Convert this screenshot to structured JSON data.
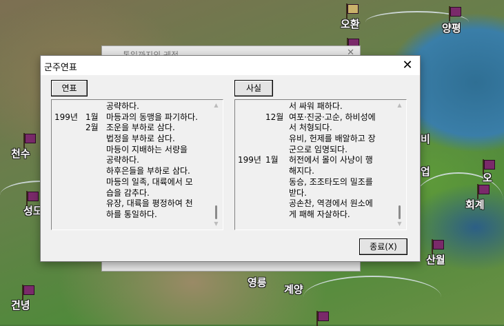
{
  "map": {
    "cities": [
      "오환",
      "양평",
      "천수",
      "성도",
      "건녕",
      "영릉",
      "계양",
      "산월",
      "회계",
      "오",
      "업",
      "비"
    ]
  },
  "back_window": {
    "title": "통일까지의 궤적"
  },
  "dialog": {
    "title": "군주연표",
    "close_glyph": "✕",
    "left_button": "연표",
    "right_button": "사실",
    "ok_button": "종료(X)",
    "left_rows": [
      {
        "year": "",
        "month": "",
        "text": "공략하다."
      },
      {
        "year": "199년",
        "month": "1월",
        "text": "마등과의 동맹을 파기하다."
      },
      {
        "year": "",
        "month": "2월",
        "text": "조운을 부하로 삼다."
      },
      {
        "year": "",
        "month": "",
        "text": "법정을 부하로 삼다."
      },
      {
        "year": "",
        "month": "",
        "text": "마등이 지배하는 서량을"
      },
      {
        "year": "",
        "month": "",
        "text": "공략하다."
      },
      {
        "year": "",
        "month": "",
        "text": "하후은들을 부하로 삼다."
      },
      {
        "year": "",
        "month": "",
        "text": "마등의 일족, 대륙에서 모"
      },
      {
        "year": "",
        "month": "",
        "text": "습을 감추다."
      },
      {
        "year": "",
        "month": "",
        "text": "유장, 대륙을 평정하여 천"
      },
      {
        "year": "",
        "month": "",
        "text": "하를 통일하다."
      }
    ],
    "right_rows": [
      {
        "year": "",
        "month": "",
        "text": "서 싸워 패하다."
      },
      {
        "year": "",
        "month": "12월",
        "text": "여포·진궁·고순, 하비성에"
      },
      {
        "year": "",
        "month": "",
        "text": "서 처형되다."
      },
      {
        "year": "",
        "month": "",
        "text": "유비, 헌제를 배알하고 장"
      },
      {
        "year": "",
        "month": "",
        "text": "군으로 임명되다."
      },
      {
        "year": "199년",
        "month": "1월",
        "text": "허전에서 몰이 사냥이 행"
      },
      {
        "year": "",
        "month": "",
        "text": "해지다."
      },
      {
        "year": "",
        "month": "",
        "text": "동승, 조조타도의 밀조를"
      },
      {
        "year": "",
        "month": "",
        "text": "받다."
      },
      {
        "year": "",
        "month": "",
        "text": "공손찬, 역경에서 원소에"
      },
      {
        "year": "",
        "month": "",
        "text": "게 패해 자살하다."
      }
    ]
  }
}
